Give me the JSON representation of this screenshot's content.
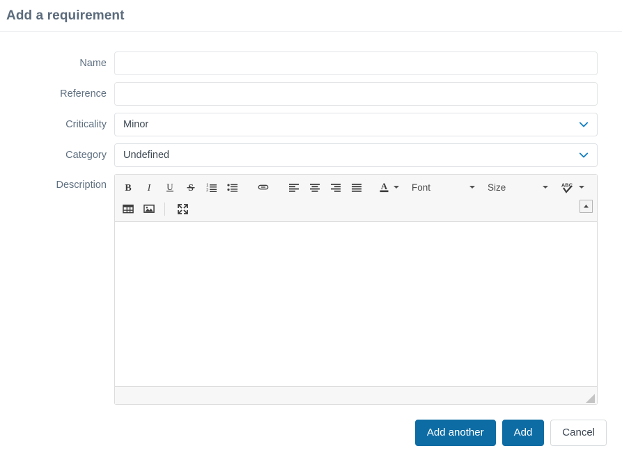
{
  "header": {
    "title": "Add a requirement"
  },
  "form": {
    "fields": [
      {
        "label": "Name",
        "type": "text",
        "value": "",
        "placeholder": ""
      },
      {
        "label": "Reference",
        "type": "text",
        "value": "",
        "placeholder": ""
      },
      {
        "label": "Criticality",
        "type": "select",
        "value": "Minor",
        "icon": "chevron-down-icon"
      },
      {
        "label": "Category",
        "type": "select",
        "value": "Undefined",
        "icon": "chevron-down-icon"
      },
      {
        "label": "Description",
        "type": "editor",
        "value": ""
      }
    ]
  },
  "editor": {
    "toolbar_row_1": [
      {
        "name": "bold-icon",
        "label": "B",
        "type": "button"
      },
      {
        "name": "italic-icon",
        "label": "I",
        "type": "button"
      },
      {
        "name": "underline-icon",
        "label": "U",
        "type": "button"
      },
      {
        "name": "strikethrough-icon",
        "label": "S",
        "type": "button"
      },
      {
        "name": "ordered-list-icon",
        "label": "",
        "type": "button"
      },
      {
        "name": "unordered-list-icon",
        "label": "",
        "type": "button"
      },
      {
        "name": "separator",
        "label": "",
        "type": "separator"
      },
      {
        "name": "link-icon",
        "label": "",
        "type": "button"
      },
      {
        "name": "separator",
        "label": "",
        "type": "separator"
      },
      {
        "name": "align-left-icon",
        "label": "",
        "type": "button"
      },
      {
        "name": "align-center-icon",
        "label": "",
        "type": "button"
      },
      {
        "name": "align-right-icon",
        "label": "",
        "type": "button"
      },
      {
        "name": "align-justify-icon",
        "label": "",
        "type": "button"
      },
      {
        "name": "separator",
        "label": "",
        "type": "separator"
      },
      {
        "name": "font-color-icon",
        "label": "A",
        "type": "dropdown"
      },
      {
        "name": "separator",
        "label": "",
        "type": "separator"
      },
      {
        "name": "font-family-dropdown",
        "label": "Font",
        "type": "dropdown"
      },
      {
        "name": "separator",
        "label": "",
        "type": "separator"
      },
      {
        "name": "font-size-dropdown",
        "label": "Size",
        "type": "dropdown"
      },
      {
        "name": "separator",
        "label": "",
        "type": "separator"
      },
      {
        "name": "spellcheck-icon",
        "label": "ABC",
        "type": "dropdown"
      },
      {
        "name": "separator",
        "label": "",
        "type": "separator"
      }
    ],
    "toolbar_row_2": [
      {
        "name": "insert-table-icon",
        "label": "",
        "type": "button"
      },
      {
        "name": "insert-image-icon",
        "label": "",
        "type": "button"
      },
      {
        "name": "separator",
        "label": "",
        "type": "separator"
      },
      {
        "name": "fullscreen-icon",
        "label": "",
        "type": "button"
      }
    ],
    "labels": {
      "font": "Font",
      "size": "Size",
      "font_color": "A",
      "spellcheck": "ABC"
    },
    "collapse_toolbar_icon": "caret-up-icon",
    "resize_handle_icon": "resize-grip-icon",
    "content": ""
  },
  "footer": {
    "buttons": [
      {
        "label": "Add another",
        "style": "primary"
      },
      {
        "label": "Add",
        "style": "primary"
      },
      {
        "label": "Cancel",
        "style": "default"
      }
    ]
  },
  "colors": {
    "primary": "#0d6ca4",
    "title": "#5b6b7c",
    "label": "#5f7081",
    "caret": "#0d7cc4",
    "toolbar_bg": "#f7f7f7",
    "border": "#dcdcdc"
  }
}
